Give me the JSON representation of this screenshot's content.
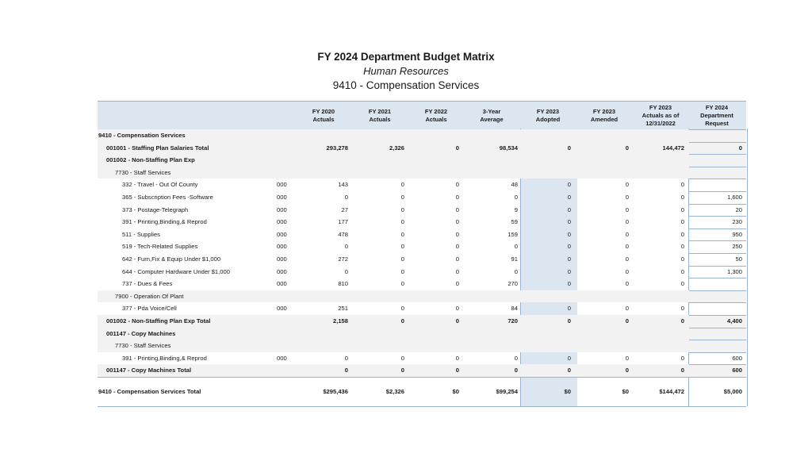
{
  "title": "FY 2024 Department Budget Matrix",
  "department": "Human Resources",
  "unit": "9410 - Compensation Services",
  "columns": [
    "FY 2020\nActuals",
    "FY 2021\nActuals",
    "FY 2022\nActuals",
    "3-Year\nAverage",
    "FY 2023\nAdopted",
    "FY 2023\nAmended",
    "FY 2023\nActuals as of\n12/31/2022",
    "FY 2024\nDepartment\nRequest"
  ],
  "rows": [
    {
      "label": "9410 - Compensation Services",
      "indent": 0,
      "style": "section",
      "code": "",
      "values": [
        "",
        "",
        "",
        "",
        "",
        "",
        "",
        ""
      ]
    },
    {
      "label": "001001 - Staffing Plan Salaries Total",
      "indent": 1,
      "style": "bold",
      "code": "",
      "values": [
        "293,278",
        "2,326",
        "0",
        "98,534",
        "0",
        "0",
        "144,472",
        "0"
      ]
    },
    {
      "label": "001002 - Non-Staffing Plan Exp",
      "indent": 1,
      "style": "section",
      "code": "",
      "values": [
        "",
        "",
        "",
        "",
        "",
        "",
        "",
        ""
      ]
    },
    {
      "label": "7730 - Staff Services",
      "indent": 2,
      "style": "group",
      "code": "",
      "values": [
        "",
        "",
        "",
        "",
        "",
        "",
        "",
        ""
      ]
    },
    {
      "label": "332 - Travel - Out Of County",
      "indent": 3,
      "style": "item",
      "code": "000",
      "values": [
        "143",
        "0",
        "0",
        "48",
        "0",
        "0",
        "0",
        ""
      ]
    },
    {
      "label": "365 - Subscription Fees -Software",
      "indent": 3,
      "style": "item",
      "code": "000",
      "values": [
        "0",
        "0",
        "0",
        "0",
        "0",
        "0",
        "0",
        "1,600"
      ]
    },
    {
      "label": "373 - Postage-Telegraph",
      "indent": 3,
      "style": "item",
      "code": "000",
      "values": [
        "27",
        "0",
        "0",
        "9",
        "0",
        "0",
        "0",
        "20"
      ]
    },
    {
      "label": "391 - Printing,Binding,& Reprod",
      "indent": 3,
      "style": "item",
      "code": "000",
      "values": [
        "177",
        "0",
        "0",
        "59",
        "0",
        "0",
        "0",
        "230"
      ]
    },
    {
      "label": "511 - Supplies",
      "indent": 3,
      "style": "item",
      "code": "000",
      "values": [
        "478",
        "0",
        "0",
        "159",
        "0",
        "0",
        "0",
        "950"
      ]
    },
    {
      "label": "519 - Tech-Related Supplies",
      "indent": 3,
      "style": "item",
      "code": "000",
      "values": [
        "0",
        "0",
        "0",
        "0",
        "0",
        "0",
        "0",
        "250"
      ]
    },
    {
      "label": "642 - Furn,Fix & Equip Under $1,000",
      "indent": 3,
      "style": "item",
      "code": "000",
      "values": [
        "272",
        "0",
        "0",
        "91",
        "0",
        "0",
        "0",
        "50"
      ]
    },
    {
      "label": "644 - Computer Hardware Under $1,000",
      "indent": 3,
      "style": "item",
      "code": "000",
      "values": [
        "0",
        "0",
        "0",
        "0",
        "0",
        "0",
        "0",
        "1,300"
      ]
    },
    {
      "label": "737 - Dues & Fees",
      "indent": 3,
      "style": "item",
      "code": "000",
      "values": [
        "810",
        "0",
        "0",
        "270",
        "0",
        "0",
        "0",
        ""
      ]
    },
    {
      "label": "7900 - Operation Of Plant",
      "indent": 2,
      "style": "group",
      "code": "",
      "values": [
        "",
        "",
        "",
        "",
        "",
        "",
        "",
        ""
      ]
    },
    {
      "label": "377 - Pda Voice/Cell",
      "indent": 3,
      "style": "item",
      "code": "000",
      "values": [
        "251",
        "0",
        "0",
        "84",
        "0",
        "0",
        "0",
        ""
      ]
    },
    {
      "label": "001002 - Non-Staffing Plan Exp Total",
      "indent": 1,
      "style": "bold",
      "code": "",
      "values": [
        "2,158",
        "0",
        "0",
        "720",
        "0",
        "0",
        "0",
        "4,400"
      ]
    },
    {
      "label": "001147 - Copy Machines",
      "indent": 1,
      "style": "section",
      "code": "",
      "values": [
        "",
        "",
        "",
        "",
        "",
        "",
        "",
        ""
      ]
    },
    {
      "label": "7730 - Staff Services",
      "indent": 2,
      "style": "group",
      "code": "",
      "values": [
        "",
        "",
        "",
        "",
        "",
        "",
        "",
        ""
      ]
    },
    {
      "label": "391 - Printing,Binding,& Reprod",
      "indent": 3,
      "style": "item",
      "code": "000",
      "values": [
        "0",
        "0",
        "0",
        "0",
        "0",
        "0",
        "0",
        "600"
      ]
    },
    {
      "label": "001147 - Copy Machines Total",
      "indent": 1,
      "style": "bold",
      "code": "",
      "values": [
        "0",
        "0",
        "0",
        "0",
        "0",
        "0",
        "0",
        "600"
      ]
    }
  ],
  "total": {
    "label": "9410 - Compensation Services Total",
    "values": [
      "$295,436",
      "$2,326",
      "$0",
      "$99,254",
      "$0",
      "$0",
      "$144,472",
      "$5,000"
    ]
  },
  "colors": {
    "header_fill": "#dce6f1",
    "border": "#9bb3d1",
    "row_shade": "#f2f2f2"
  }
}
